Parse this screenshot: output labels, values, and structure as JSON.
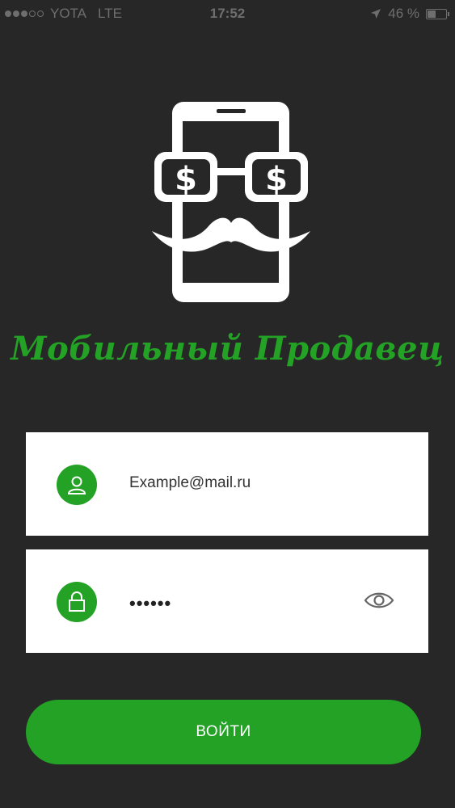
{
  "status_bar": {
    "carrier": "YOTA",
    "network": "LTE",
    "time": "17:52",
    "battery": "46 %",
    "battery_level": 0.46
  },
  "app": {
    "title": "Мобильный Продавец",
    "logo_icon": "phone-glasses-mustache-logo",
    "accent_color": "#23a226",
    "background_color": "#272727"
  },
  "login_form": {
    "email_value": "Example@mail.ru",
    "email_icon": "user-icon",
    "password_masked": "••••••",
    "password_icon": "lock-icon",
    "show_password_icon": "eye-icon",
    "submit_label": "ВОЙТИ"
  }
}
